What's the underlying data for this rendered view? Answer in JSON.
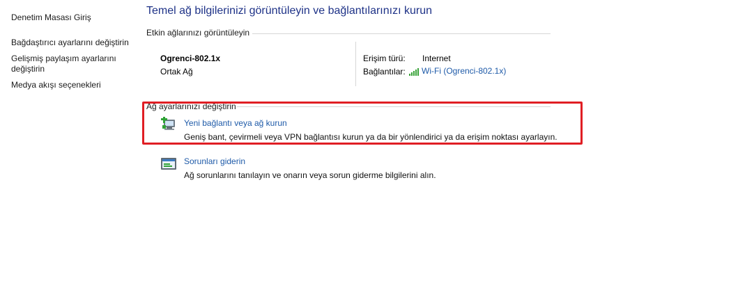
{
  "sidebar": {
    "items": [
      {
        "label": "Denetim Masası Giriş"
      },
      {
        "label": "Bağdaştırıcı ayarlarını değiştirin"
      },
      {
        "label": "Gelişmiş paylaşım ayarlarını değiştirin"
      },
      {
        "label": "Medya akışı seçenekleri"
      }
    ]
  },
  "header": {
    "title": "Temel ağ bilgilerinizi görüntüleyin ve bağlantılarınızı kurun"
  },
  "active_networks": {
    "heading": "Etkin ağlarınızı görüntüleyin",
    "network_name": "Ogrenci-802.1x",
    "network_category": "Ortak Ağ",
    "access_type_label": "Erişim türü:",
    "access_type_value": "Internet",
    "connections_label": "Bağlantılar:",
    "connection_value": "Wi-Fi (Ogrenci-802.1x)",
    "signal_icon": "wifi-signal-icon",
    "signal_color": "#3aa33a"
  },
  "change_settings": {
    "heading": "Ağ ayarlarınızı değiştirin",
    "highlight_color": "#e01e24",
    "tasks": [
      {
        "icon": "new-connection-icon",
        "title": "Yeni bağlantı veya ağ kurun",
        "description": "Geniş bant, çevirmeli veya VPN bağlantısı kurun ya da bir yönlendirici ya da erişim noktası ayarlayın."
      },
      {
        "icon": "troubleshoot-icon",
        "title": "Sorunları giderin",
        "description": "Ağ sorunlarını tanılayın ve onarın veya sorun giderme bilgilerini alın."
      }
    ]
  }
}
